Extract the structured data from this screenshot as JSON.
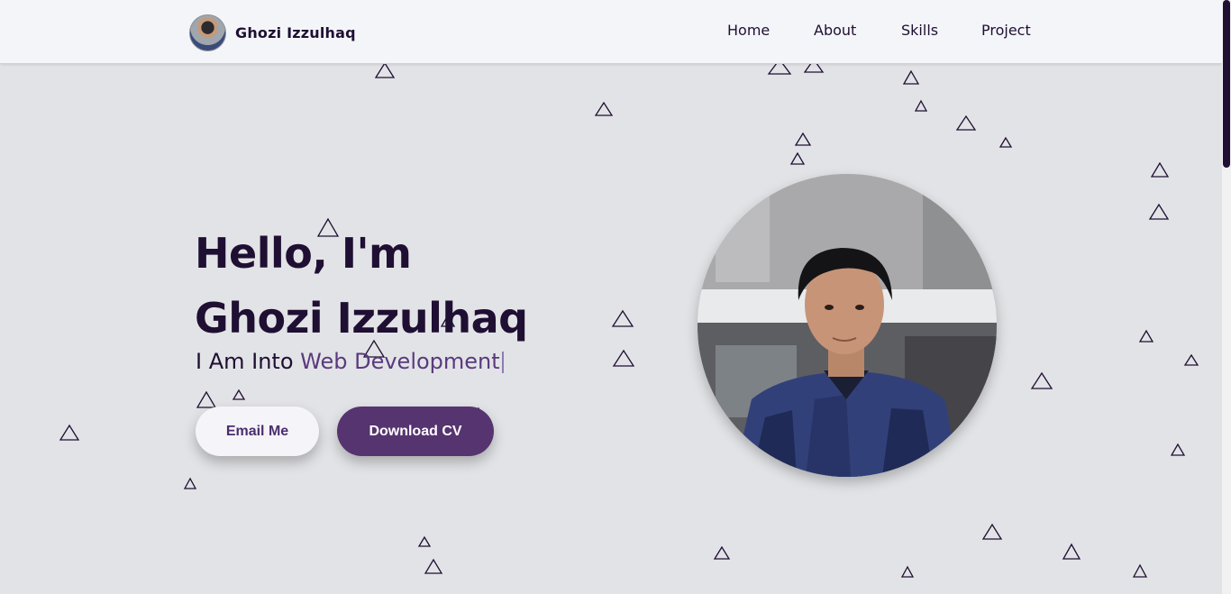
{
  "header": {
    "brand_name": "Ghozi Izzulhaq",
    "nav": [
      "Home",
      "About",
      "Skills",
      "Project"
    ]
  },
  "hero": {
    "title_line1": "Hello, I'm",
    "title_line2": "Ghozi Izzulhaq",
    "subtitle_prefix": "I Am Into ",
    "subtitle_typed": "Web Development",
    "email_button": "Email Me",
    "cv_button": "Download CV"
  },
  "colors": {
    "background": "#e2e3e6",
    "navbar": "#f4f5f8",
    "text_dark": "#1f0f33",
    "accent_purple": "#56346f",
    "typed_text": "#5a3a7e"
  },
  "icons": [
    "triangle-particle-icon"
  ]
}
